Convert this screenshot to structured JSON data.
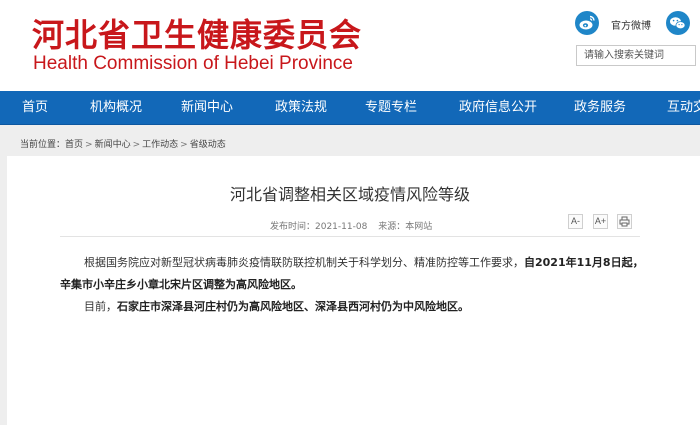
{
  "header": {
    "title_cn": "河北省卫生健康委员会",
    "title_en": "Health Commission of Hebei Province",
    "weibo_label": "官方微博",
    "search_placeholder": "请输入搜索关键词",
    "icons": {
      "weibo": "weibo-icon",
      "weixin": "wechat-icon"
    },
    "brand_color": "#c8171b"
  },
  "nav": {
    "background": "#1268b8",
    "items": [
      "首页",
      "机构概况",
      "新闻中心",
      "政策法规",
      "专题专栏",
      "政府信息公开",
      "政务服务",
      "互动交"
    ]
  },
  "breadcrumb": {
    "prefix": "当前位置：",
    "items": [
      "首页",
      "新闻中心",
      "工作动态",
      "省级动态"
    ],
    "separator": ">"
  },
  "article": {
    "title": "河北省调整相关区域疫情风险等级",
    "publish_date": "发布时间：2021-11-08",
    "source": "来源：本网站",
    "tools": [
      "A-",
      "A+",
      "print-icon"
    ],
    "p1_normal": "根据国务院应对新型冠状病毒肺炎疫情联防联控机制关于科学划分、精准防控等工作要求，",
    "p1_bold": "自2021年11月8日起，辛集市小辛庄乡小章北宋片区调整为高风险地区。",
    "p2_normal": "目前，",
    "p2_bold": "石家庄市深泽县河庄村仍为高风险地区、深泽县西河村仍为中风险地区。"
  }
}
